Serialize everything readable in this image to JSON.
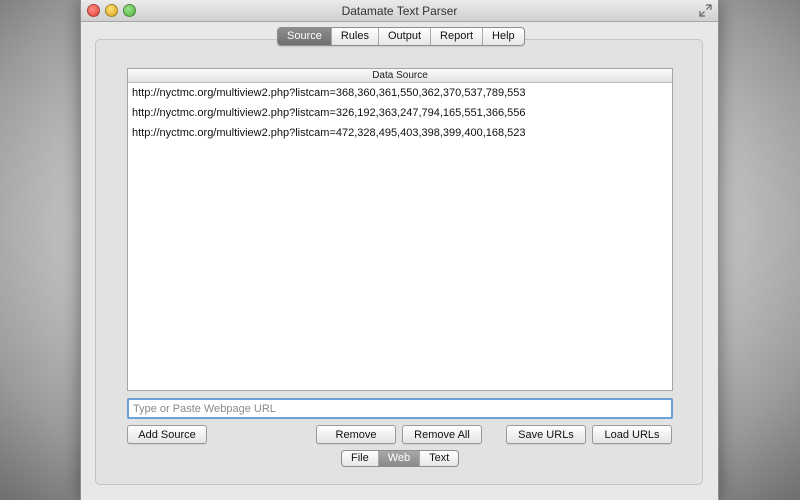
{
  "window": {
    "title": "Datamate Text Parser"
  },
  "tabs": [
    {
      "label": "Source",
      "active": true
    },
    {
      "label": "Rules",
      "active": false
    },
    {
      "label": "Output",
      "active": false
    },
    {
      "label": "Report",
      "active": false
    },
    {
      "label": "Help",
      "active": false
    }
  ],
  "data_source": {
    "header": "Data Source",
    "urls": [
      "http://nyctmc.org/multiview2.php?listcam=368,360,361,550,362,370,537,789,553",
      "http://nyctmc.org/multiview2.php?listcam=326,192,363,247,794,165,551,366,556",
      "http://nyctmc.org/multiview2.php?listcam=472,328,495,403,398,399,400,168,523"
    ]
  },
  "url_input": {
    "placeholder": "Type or Paste Webpage URL",
    "value": ""
  },
  "buttons": {
    "add_source": "Add Source",
    "remove": "Remove",
    "remove_all": "Remove All",
    "save_urls": "Save URLs",
    "load_urls": "Load URLs"
  },
  "modes": [
    {
      "label": "File",
      "active": false
    },
    {
      "label": "Web",
      "active": true
    },
    {
      "label": "Text",
      "active": false
    }
  ]
}
